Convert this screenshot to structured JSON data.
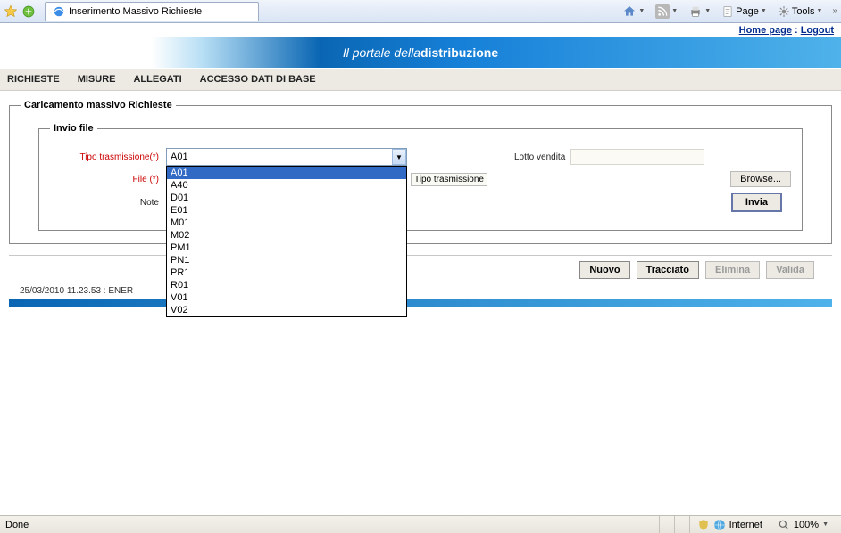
{
  "browser": {
    "tab_title": "Inserimento Massivo Richieste",
    "page_btn": "Page",
    "tools_btn": "Tools",
    "done": "Done",
    "zone": "Internet",
    "zoom": "100%"
  },
  "top_links": {
    "home": "Home page",
    "logout": "Logout"
  },
  "banner": {
    "text_left": "Il portale della ",
    "text_bold": "distribuzione"
  },
  "menu": {
    "richieste": "RICHIESTE",
    "misure": "MISURE",
    "allegati": "ALLEGATI",
    "accesso": "ACCESSO DATI DI BASE"
  },
  "fieldset": {
    "legend_outer": "Caricamento massivo Richieste",
    "legend_inner": "Invio file"
  },
  "form": {
    "tipo_label": "Tipo trasmissione(*)",
    "tipo_value": "A01",
    "lotto_label": "Lotto vendita",
    "file_label": "File (*)",
    "file_hint": "Tipo trasmissione",
    "browse": "Browse...",
    "note_label": "Note",
    "invia": "Invia"
  },
  "dropdown": {
    "options": [
      "A01",
      "A40",
      "D01",
      "E01",
      "M01",
      "M02",
      "PM1",
      "PN1",
      "PR1",
      "R01",
      "V01",
      "V02"
    ]
  },
  "actions": {
    "nuovo": "Nuovo",
    "tracciato": "Tracciato",
    "elimina": "Elimina",
    "valida": "Valida"
  },
  "status_row": {
    "text": "25/03/2010 11.23.53  :   ENER"
  }
}
